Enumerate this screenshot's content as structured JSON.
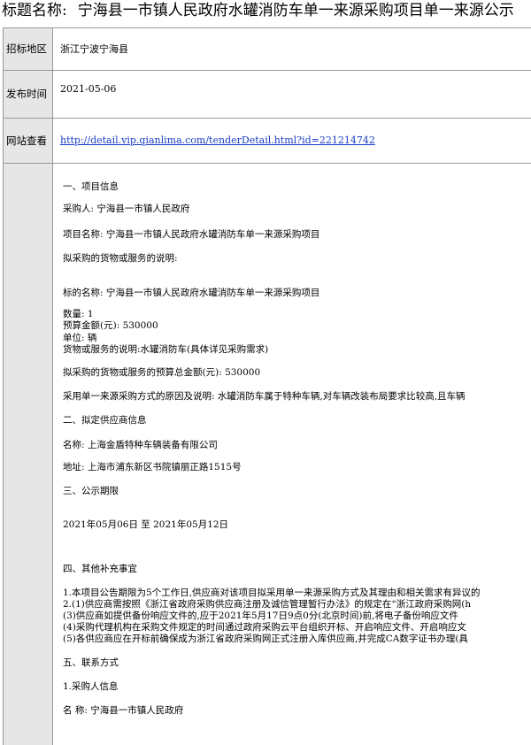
{
  "title": {
    "label": "标题名称:",
    "text": "宁海县一市镇人民政府水罐消防车单一来源采购项目单一来源公示"
  },
  "rows": {
    "region": {
      "label": "招标地区",
      "value": "浙江宁波宁海县"
    },
    "publish": {
      "label": "发布时间",
      "value": "2021-05-06"
    },
    "website": {
      "label": "网站查看",
      "value": "http://detail.vip.qianlima.com/tenderDetail.html?id=221214742"
    }
  },
  "content": {
    "sec1": "一、项目信息",
    "buyer": "采购人:   宁海县一市镇人民政府",
    "project_name": "项目名称:   宁海县一市镇人民政府水罐消防车单一来源采购项目",
    "goods_desc_label": "拟采购的货物或服务的说明:",
    "item_name": "标的名称:   宁海县一市镇人民政府水罐消防车单一来源采购项目",
    "quantity": "数量:   1",
    "budget": "预算金额(元):   530000",
    "unit": "单位:   辆",
    "goods_desc": "货物或服务的说明:水罐消防车(具体详见采购需求)",
    "total_budget": "拟采购的货物或服务的预算总金额(元):   530000",
    "reason": "采用单一来源采购方式的原因及说明:   水罐消防车属于特种车辆,对车辆改装布局要求比较高,且车辆",
    "sec2": "二、拟定供应商信息",
    "supplier_name": "名称:   上海金盾特种车辆装备有限公司",
    "supplier_addr": "地址:   上海市浦东新区书院镇丽正路1515号",
    "sec3": "三、公示期限",
    "period": "2021年05月06日  至  2021年05月12日",
    "sec4": "四、其他补充事宜",
    "note1": "1.本项目公告期限为5个工作日,供应商对该项目拟采用单一来源采购方式及其理由和相关需求有异议的",
    "note2": "2.(1)供应商需按照《浙江省政府采购供应商注册及诚信管理暂行办法》的规定在“浙江政府采购网(h",
    "note3": "(3)供应商如提供备份响应文件的,应于2021年5月17日9点0分(北京时间)前,将电子备份响应文件",
    "note4": "(4)采购代理机构在采购文件规定的时间通过政府采购云平台组织开标、开启响应文件、开启响应文",
    "note5": "(5)各供应商应在开标前确保成为浙江省政府采购网正式注册入库供应商,并完成CA数字证书办理(具",
    "sec5": "五、联系方式",
    "contact_sub": "1.采购人信息",
    "contact_name": "名  称:   宁海县一市镇人民政府"
  }
}
